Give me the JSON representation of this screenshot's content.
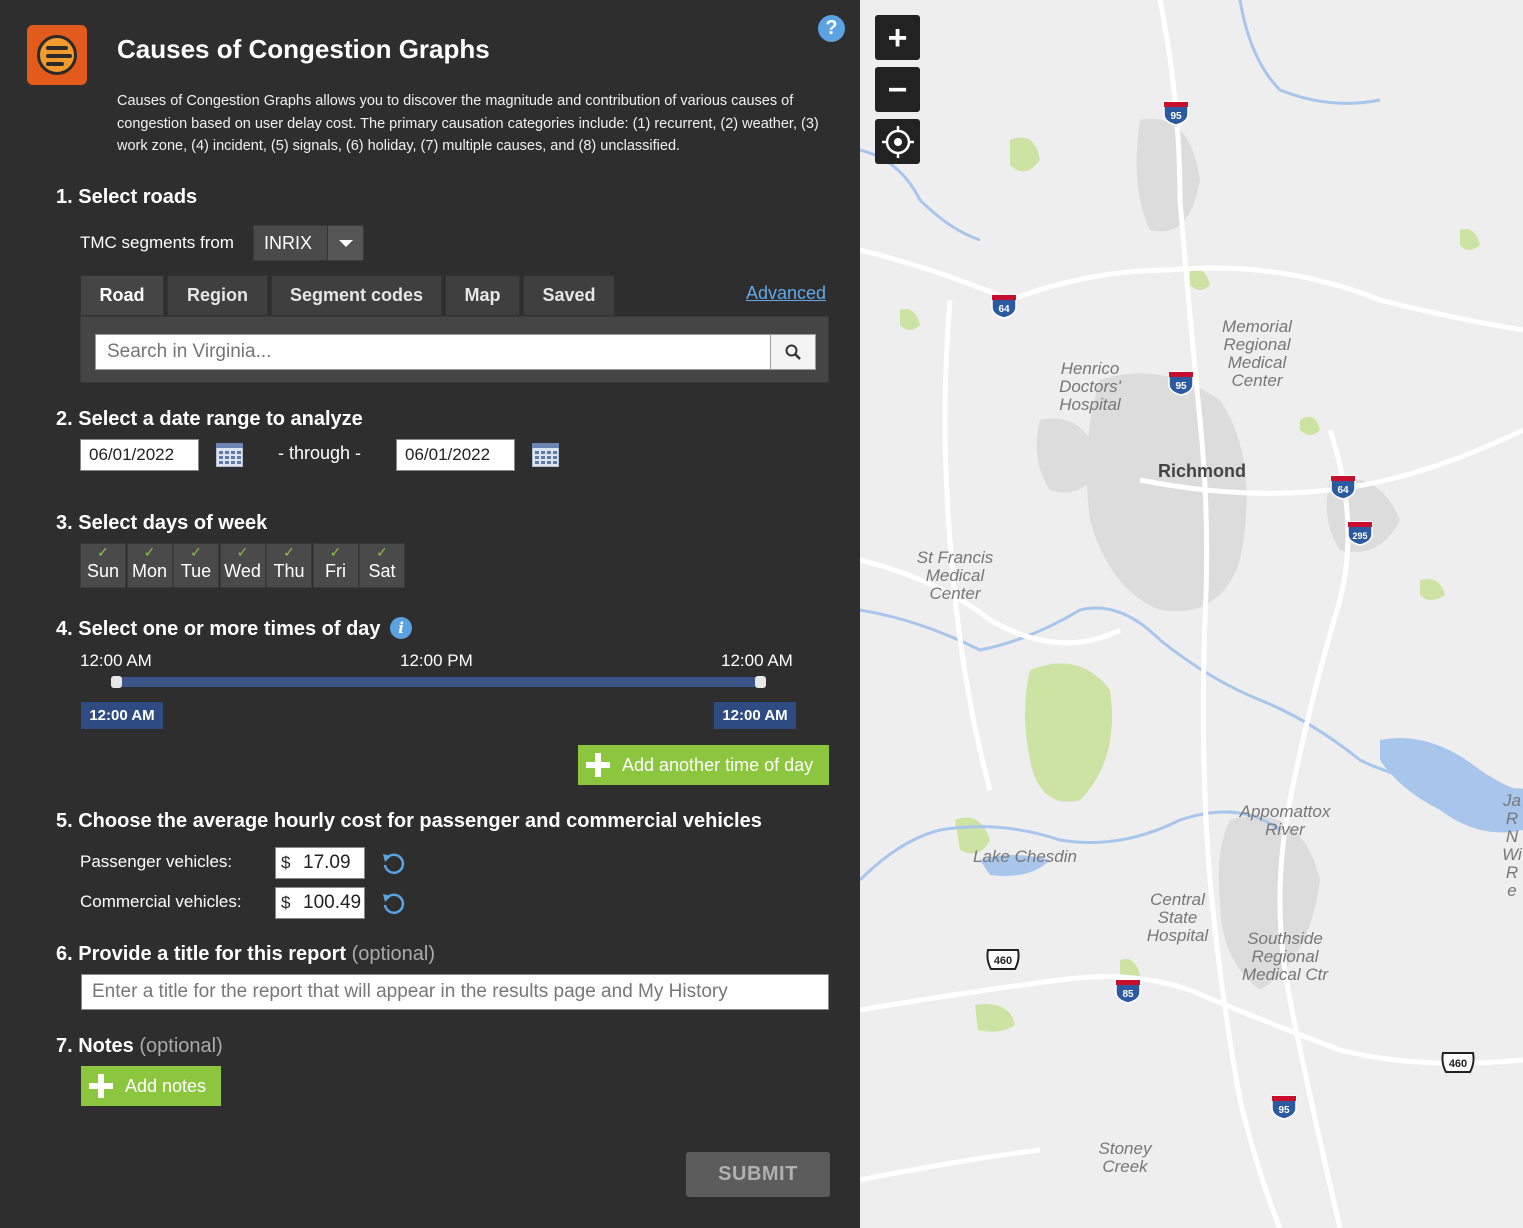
{
  "app": {
    "title": "Causes of Congestion Graphs",
    "description": "Causes of Congestion Graphs allows you to discover the magnitude and contribution of various causes of congestion based on user delay cost. The primary causation categories include: (1) recurrent, (2) weather, (3) work zone, (4) incident, (5) signals, (6) holiday, (7) multiple causes, and (8) unclassified.",
    "help_label": "?"
  },
  "step1": {
    "heading": "1. Select roads",
    "source_label": "TMC segments from",
    "source_value": "INRIX",
    "tabs": [
      {
        "label": "Road",
        "active": true
      },
      {
        "label": "Region",
        "active": false
      },
      {
        "label": "Segment codes",
        "active": false
      },
      {
        "label": "Map",
        "active": false
      },
      {
        "label": "Saved",
        "active": false
      }
    ],
    "advanced_label": "Advanced",
    "search_placeholder": "Search in Virginia..."
  },
  "step2": {
    "heading": "2. Select a date range to analyze",
    "start_date": "06/01/2022",
    "through_label": "- through -",
    "end_date": "06/01/2022"
  },
  "step3": {
    "heading": "3. Select days of week",
    "check_glyph": "✓",
    "days": [
      {
        "label": "Sun",
        "checked": true
      },
      {
        "label": "Mon",
        "checked": true
      },
      {
        "label": "Tue",
        "checked": true
      },
      {
        "label": "Wed",
        "checked": true
      },
      {
        "label": "Thu",
        "checked": true
      },
      {
        "label": "Fri",
        "checked": true
      },
      {
        "label": "Sat",
        "checked": true
      }
    ]
  },
  "step4": {
    "heading": "4. Select one or more times of day",
    "info_label": "i",
    "scale_labels": [
      "12:00 AM",
      "12:00 PM",
      "12:00 AM"
    ],
    "range_start": "12:00 AM",
    "range_end": "12:00 AM",
    "add_time_label": "Add another time of day"
  },
  "step5": {
    "heading": "5. Choose the average hourly cost for passenger and commercial vehicles",
    "currency": "$",
    "passenger_label": "Passenger vehicles:",
    "passenger_value": "17.09",
    "commercial_label": "Commercial vehicles:",
    "commercial_value": "100.49"
  },
  "step6": {
    "heading": "6. Provide a title for this report",
    "optional": "(optional)",
    "placeholder": "Enter a title for the report that will appear in the results page and My History"
  },
  "step7": {
    "heading": "7. Notes",
    "optional": "(optional)",
    "add_notes_label": "Add notes"
  },
  "submit_label": "SUBMIT",
  "map": {
    "zoom_in": "+",
    "zoom_out": "−",
    "city": "Richmond",
    "places": [
      {
        "id": "memorial",
        "text": "Memorial Regional Medical Center"
      },
      {
        "id": "henrico",
        "text": "Henrico Doctors' Hospital"
      },
      {
        "id": "stfrancis",
        "text": "St Francis Medical Center"
      },
      {
        "id": "appomattox",
        "text": "Appomattox River"
      },
      {
        "id": "chesdin",
        "text": "Lake Chesdin"
      },
      {
        "id": "centralstate",
        "text": "Central State Hospital"
      },
      {
        "id": "southside",
        "text": "Southside Regional Medical Ctr"
      },
      {
        "id": "stoney",
        "text": "Stoney Creek"
      },
      {
        "id": "edge",
        "text": "Ja R N Wi Re"
      }
    ],
    "shields": [
      {
        "id": "i95-north",
        "text": "95",
        "type": "interstate"
      },
      {
        "id": "i64-west",
        "text": "64",
        "type": "interstate"
      },
      {
        "id": "i95-mid",
        "text": "95",
        "type": "interstate"
      },
      {
        "id": "i64-east",
        "text": "64",
        "type": "interstate"
      },
      {
        "id": "i295",
        "text": "295",
        "type": "interstate"
      },
      {
        "id": "i85",
        "text": "85",
        "type": "interstate"
      },
      {
        "id": "i95-south",
        "text": "95",
        "type": "interstate"
      },
      {
        "id": "us460-west",
        "text": "460",
        "type": "us"
      },
      {
        "id": "us460-east",
        "text": "460",
        "type": "us"
      }
    ],
    "colors": {
      "land": "#eeeeee",
      "water": "#a8c6ec",
      "park": "#cde3a3",
      "urban": "#dcdcdc",
      "road": "#ffffff"
    }
  }
}
